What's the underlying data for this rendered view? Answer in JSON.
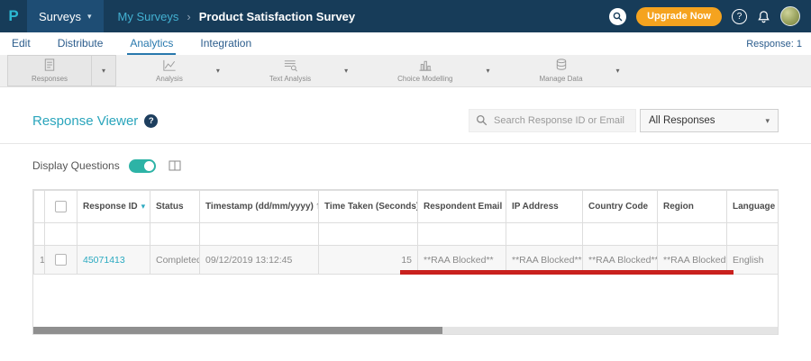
{
  "icons": {
    "caret_down": "▾",
    "sort_desc": "▾",
    "sort_both": "⇅",
    "breadcrumb_separator": "›",
    "help_glyph": "?"
  },
  "topbar": {
    "logo_letter": "P",
    "surveys_label": "Surveys",
    "breadcrumb": {
      "parent": "My Surveys",
      "current": "Product Satisfaction Survey"
    },
    "upgrade_label": "Upgrade Now"
  },
  "nav": {
    "tabs": [
      {
        "label": "Edit"
      },
      {
        "label": "Distribute"
      },
      {
        "label": "Analytics"
      },
      {
        "label": "Integration"
      }
    ],
    "active_tab": "Analytics",
    "response_count": "Response: 1"
  },
  "toolbar": {
    "items": [
      {
        "label": "Responses"
      },
      {
        "label": "Analysis"
      },
      {
        "label": "Text Analysis"
      },
      {
        "label": "Choice Modelling"
      },
      {
        "label": "Manage Data"
      }
    ],
    "selected": "Responses"
  },
  "viewer": {
    "title": "Response Viewer",
    "search_placeholder": "Search Response ID or Email",
    "responses_filter_value": "All Responses",
    "display_questions_label": "Display Questions",
    "display_questions_on": true
  },
  "table": {
    "headers": {
      "response_id": "Response ID",
      "status": "Status",
      "timestamp": "Timestamp (dd/mm/yyyy)",
      "time_taken": "Time Taken (Seconds)",
      "respondent_email": "Respondent Email",
      "ip_address": "IP Address",
      "country_code": "Country Code",
      "region": "Region",
      "language": "Language"
    },
    "rows": [
      {
        "row_number": "1",
        "response_id": "45071413",
        "status": "Completed",
        "timestamp": "09/12/2019 13:12:45",
        "time_taken": "15",
        "respondent_email": "**RAA Blocked**",
        "ip_address": "**RAA Blocked**",
        "country_code": "**RAA Blocked**",
        "region": "**RAA Blocked**",
        "language": "English"
      }
    ]
  },
  "colors": {
    "topbar_bg": "#173c59",
    "accent_teal": "#2aa9c0",
    "upgrade_orange": "#f5a31f",
    "annotation_red": "#c9211e",
    "toggle_teal": "#2db3a6"
  }
}
